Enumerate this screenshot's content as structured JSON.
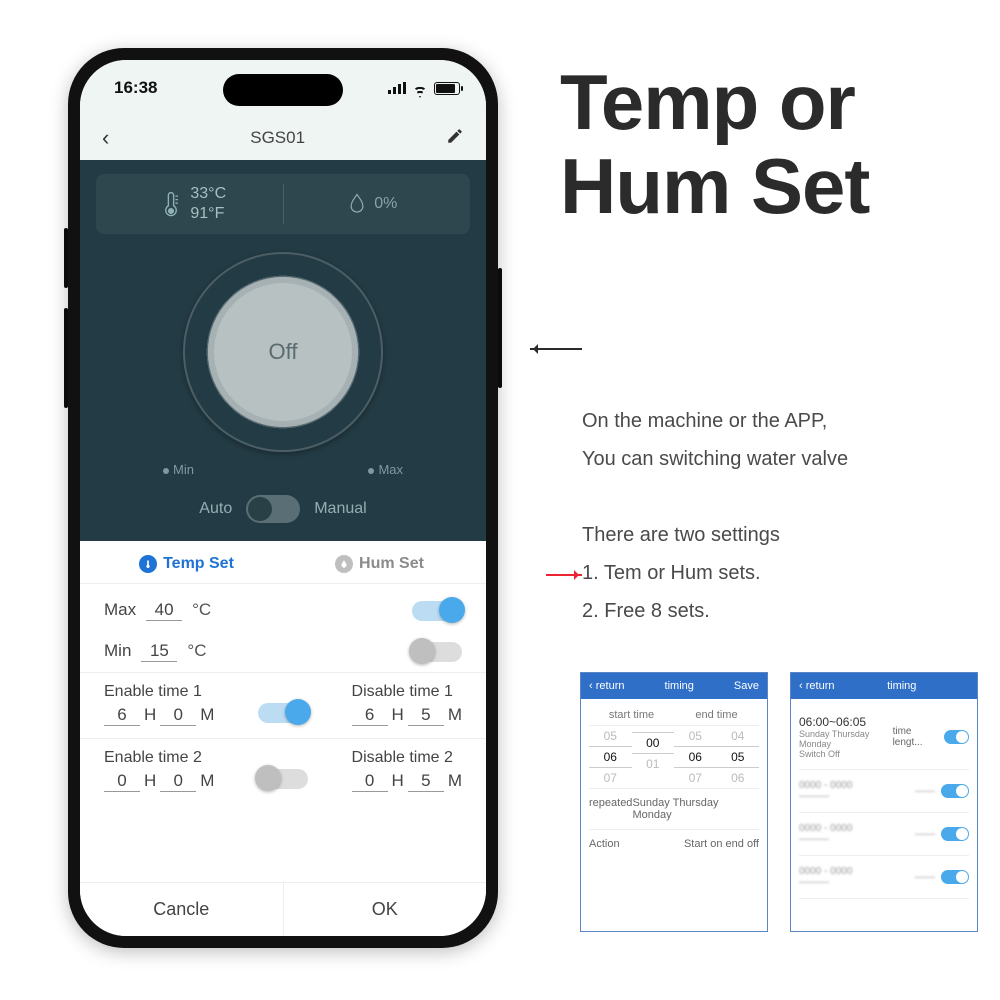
{
  "status": {
    "time": "16:38"
  },
  "header": {
    "title": "SGS01"
  },
  "readings": {
    "temp_c": "33°C",
    "temp_f": "91°F",
    "humidity": "0%"
  },
  "dial": {
    "state": "Off",
    "min": "Min",
    "max": "Max"
  },
  "mode": {
    "auto": "Auto",
    "manual": "Manual"
  },
  "tabs": {
    "temp": "Temp Set",
    "hum": "Hum Set"
  },
  "settings": {
    "max_label": "Max",
    "max_value": "40",
    "max_unit": "°C",
    "min_label": "Min",
    "min_value": "15",
    "min_unit": "°C"
  },
  "time1": {
    "enable_label": "Enable time 1",
    "disable_label": "Disable time 1",
    "eh": "6",
    "em": "0",
    "dh": "6",
    "dm": "5",
    "H": "H",
    "M": "M"
  },
  "time2": {
    "enable_label": "Enable time 2",
    "disable_label": "Disable time 2",
    "eh": "0",
    "em": "0",
    "dh": "0",
    "dm": "5",
    "H": "H",
    "M": "M"
  },
  "buttons": {
    "cancel": "Cancle",
    "ok": "OK"
  },
  "promo": {
    "title1": "Temp or",
    "title2": "Hum Set",
    "desc1": "On the machine or the APP,",
    "desc2": "You can switching water valve",
    "list_intro": "There are two settings",
    "item1": "1.  Tem or Hum sets.",
    "item2": "2.  Free 8 sets."
  },
  "thumb1": {
    "return": "return",
    "title": "timing",
    "save": "Save",
    "start": "start time",
    "end": "end time",
    "r1a": "05",
    "r1b": "",
    "r1c": "05",
    "r1d": "04",
    "r2a": "06",
    "r2b": "00",
    "r2c": "06",
    "r2d": "05",
    "r3a": "07",
    "r3b": "01",
    "r3c": "07",
    "r3d": "06",
    "rep": "repeated",
    "repv": "Sunday Thursday Monday",
    "act": "Action",
    "actv": "Start on end off"
  },
  "thumb2": {
    "return": "return",
    "title": "timing",
    "line1a": "06:00~06:05",
    "line1b": "time lengt...",
    "sub": "Sunday Thursday Monday",
    "sub2": "Switch Off"
  }
}
